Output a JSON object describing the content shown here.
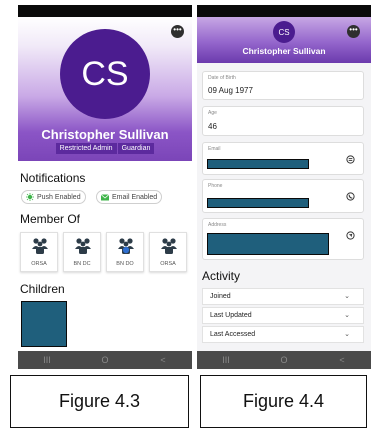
{
  "left": {
    "avatar_initials": "CS",
    "name": "Christopher Sullivan",
    "roles": [
      "Restricted Admin",
      "Guardian"
    ],
    "notifications_title": "Notifications",
    "chips": [
      {
        "label": "Push Enabled",
        "icon": "bell-icon",
        "color": "#3fb44a"
      },
      {
        "label": "Email Enabled",
        "icon": "envelope-icon",
        "color": "#3fb44a"
      }
    ],
    "member_title": "Member Of",
    "members": [
      {
        "label": "ORSA",
        "icon": "group-icon"
      },
      {
        "label": "BN DC",
        "icon": "group-icon"
      },
      {
        "label": "BN DO",
        "icon": "group-icon"
      },
      {
        "label": "ORSA",
        "icon": "group-icon"
      }
    ],
    "children_title": "Children",
    "nav": [
      "III",
      "O",
      "<"
    ]
  },
  "right": {
    "avatar_initials": "CS",
    "name": "Christopher Sullivan",
    "fields": {
      "dob": {
        "label": "Date of Birth",
        "value": "09 Aug 1977"
      },
      "age": {
        "label": "Age",
        "value": "46"
      },
      "email": {
        "label": "Email",
        "icon": "at-icon"
      },
      "phone": {
        "label": "Phone",
        "icon": "phone-icon"
      },
      "address": {
        "label": "Address",
        "icon": "location-icon"
      }
    },
    "activity_title": "Activity",
    "activity_rows": [
      "Joined",
      "Last Updated",
      "Last Accessed"
    ],
    "nav": [
      "III",
      "O",
      "<"
    ]
  },
  "captions": [
    "Figure 4.3",
    "Figure 4.4"
  ],
  "colors": {
    "brand_purple": "#4b1c8f",
    "redaction": "#1f5f7c"
  }
}
